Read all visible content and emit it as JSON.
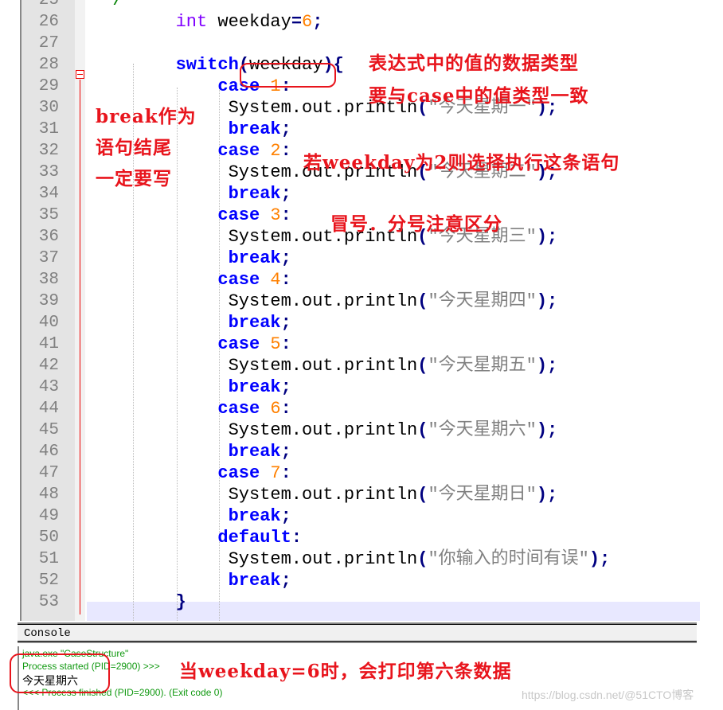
{
  "editor": {
    "first_line_partial": "25",
    "lines": [
      {
        "n": "25",
        "indent": 0,
        "tokens": [
          {
            "t": "  /",
            "c": "cm"
          }
        ]
      },
      {
        "n": "26",
        "indent": 8,
        "tokens": [
          {
            "t": "int",
            "c": "ty"
          },
          {
            "t": " weekday",
            "c": "id"
          },
          {
            "t": "=",
            "c": "op"
          },
          {
            "t": "6",
            "c": "num"
          },
          {
            "t": ";",
            "c": "op"
          }
        ]
      },
      {
        "n": "27",
        "indent": 8,
        "tokens": []
      },
      {
        "n": "28",
        "indent": 8,
        "tokens": [
          {
            "t": "switch",
            "c": "kw"
          },
          {
            "t": "(",
            "c": "op"
          },
          {
            "t": "weekday",
            "c": "id"
          },
          {
            "t": ")",
            "c": "op"
          },
          {
            "t": "{",
            "c": "op"
          }
        ]
      },
      {
        "n": "29",
        "indent": 12,
        "tokens": [
          {
            "t": "case",
            "c": "kw"
          },
          {
            "t": " 1",
            "c": "num"
          },
          {
            "t": ":",
            "c": "op"
          }
        ]
      },
      {
        "n": "30",
        "indent": 13,
        "tokens": [
          {
            "t": "System.out.println",
            "c": "id"
          },
          {
            "t": "(",
            "c": "op"
          },
          {
            "t": "\"今天星期一\"",
            "c": "str"
          },
          {
            "t": ");",
            "c": "op"
          }
        ]
      },
      {
        "n": "31",
        "indent": 13,
        "tokens": [
          {
            "t": "break",
            "c": "kw"
          },
          {
            "t": ";",
            "c": "op"
          }
        ]
      },
      {
        "n": "32",
        "indent": 12,
        "tokens": [
          {
            "t": "case",
            "c": "kw"
          },
          {
            "t": " 2",
            "c": "num"
          },
          {
            "t": ":",
            "c": "op"
          }
        ]
      },
      {
        "n": "33",
        "indent": 13,
        "tokens": [
          {
            "t": "System.out.println",
            "c": "id"
          },
          {
            "t": "(",
            "c": "op"
          },
          {
            "t": "\"今天星期二\"",
            "c": "str"
          },
          {
            "t": ");",
            "c": "op"
          }
        ]
      },
      {
        "n": "34",
        "indent": 13,
        "tokens": [
          {
            "t": "break",
            "c": "kw"
          },
          {
            "t": ";",
            "c": "op"
          }
        ]
      },
      {
        "n": "35",
        "indent": 12,
        "tokens": [
          {
            "t": "case",
            "c": "kw"
          },
          {
            "t": " 3",
            "c": "num"
          },
          {
            "t": ":",
            "c": "op"
          }
        ]
      },
      {
        "n": "36",
        "indent": 13,
        "tokens": [
          {
            "t": "System.out.println",
            "c": "id"
          },
          {
            "t": "(",
            "c": "op"
          },
          {
            "t": "\"今天星期三\"",
            "c": "str"
          },
          {
            "t": ");",
            "c": "op"
          }
        ]
      },
      {
        "n": "37",
        "indent": 13,
        "tokens": [
          {
            "t": "break",
            "c": "kw"
          },
          {
            "t": ";",
            "c": "op"
          }
        ]
      },
      {
        "n": "38",
        "indent": 12,
        "tokens": [
          {
            "t": "case",
            "c": "kw"
          },
          {
            "t": " 4",
            "c": "num"
          },
          {
            "t": ":",
            "c": "op"
          }
        ]
      },
      {
        "n": "39",
        "indent": 13,
        "tokens": [
          {
            "t": "System.out.println",
            "c": "id"
          },
          {
            "t": "(",
            "c": "op"
          },
          {
            "t": "\"今天星期四\"",
            "c": "str"
          },
          {
            "t": ");",
            "c": "op"
          }
        ]
      },
      {
        "n": "40",
        "indent": 13,
        "tokens": [
          {
            "t": "break",
            "c": "kw"
          },
          {
            "t": ";",
            "c": "op"
          }
        ]
      },
      {
        "n": "41",
        "indent": 12,
        "tokens": [
          {
            "t": "case",
            "c": "kw"
          },
          {
            "t": " 5",
            "c": "num"
          },
          {
            "t": ":",
            "c": "op"
          }
        ]
      },
      {
        "n": "42",
        "indent": 13,
        "tokens": [
          {
            "t": "System.out.println",
            "c": "id"
          },
          {
            "t": "(",
            "c": "op"
          },
          {
            "t": "\"今天星期五\"",
            "c": "str"
          },
          {
            "t": ");",
            "c": "op"
          }
        ]
      },
      {
        "n": "43",
        "indent": 13,
        "tokens": [
          {
            "t": "break",
            "c": "kw"
          },
          {
            "t": ";",
            "c": "op"
          }
        ]
      },
      {
        "n": "44",
        "indent": 12,
        "tokens": [
          {
            "t": "case",
            "c": "kw"
          },
          {
            "t": " 6",
            "c": "num"
          },
          {
            "t": ":",
            "c": "op"
          }
        ]
      },
      {
        "n": "45",
        "indent": 13,
        "tokens": [
          {
            "t": "System.out.println",
            "c": "id"
          },
          {
            "t": "(",
            "c": "op"
          },
          {
            "t": "\"今天星期六\"",
            "c": "str"
          },
          {
            "t": ");",
            "c": "op"
          }
        ]
      },
      {
        "n": "46",
        "indent": 13,
        "tokens": [
          {
            "t": "break",
            "c": "kw"
          },
          {
            "t": ";",
            "c": "op"
          }
        ]
      },
      {
        "n": "47",
        "indent": 12,
        "tokens": [
          {
            "t": "case",
            "c": "kw"
          },
          {
            "t": " 7",
            "c": "num"
          },
          {
            "t": ":",
            "c": "op"
          }
        ]
      },
      {
        "n": "48",
        "indent": 13,
        "tokens": [
          {
            "t": "System.out.println",
            "c": "id"
          },
          {
            "t": "(",
            "c": "op"
          },
          {
            "t": "\"今天星期日\"",
            "c": "str"
          },
          {
            "t": ");",
            "c": "op"
          }
        ]
      },
      {
        "n": "49",
        "indent": 13,
        "tokens": [
          {
            "t": "break",
            "c": "kw"
          },
          {
            "t": ";",
            "c": "op"
          }
        ]
      },
      {
        "n": "50",
        "indent": 12,
        "tokens": [
          {
            "t": "default",
            "c": "kw"
          },
          {
            "t": ":",
            "c": "op"
          }
        ]
      },
      {
        "n": "51",
        "indent": 13,
        "tokens": [
          {
            "t": "System.out.println",
            "c": "id"
          },
          {
            "t": "(",
            "c": "op"
          },
          {
            "t": "\"你输入的时间有误\"",
            "c": "str"
          },
          {
            "t": ");",
            "c": "op"
          }
        ]
      },
      {
        "n": "52",
        "indent": 13,
        "tokens": [
          {
            "t": "break",
            "c": "kw"
          },
          {
            "t": ";",
            "c": "op"
          }
        ]
      },
      {
        "n": "53",
        "indent": 8,
        "tokens": [
          {
            "t": "}",
            "c": "op"
          }
        ]
      }
    ]
  },
  "console": {
    "tab_label": "Console",
    "lines": [
      {
        "text": "java.exe \"CaseStructure\"",
        "color": "#119911"
      },
      {
        "text": "Process started (PID=2900) >>>",
        "color": "#119911"
      },
      {
        "text": "今天星期六",
        "color": "#000000"
      },
      {
        "text": "<<< Process finished (PID=2900). (Exit code 0)",
        "color": "#119911"
      }
    ]
  },
  "annotations": {
    "expr_type_1": "表达式中的值的数据类型",
    "expr_type_2": "要与case中的值类型一致",
    "break_1": "break作为",
    "break_2": "语句结尾",
    "break_3": "一定要写",
    "case2": "若weekday为2则选择执行这条语句",
    "colon": "冒号．分号注意区分",
    "result": "当weekday=6时，会打印第六条数据",
    "color": "#e8141c"
  },
  "watermark": "https://blog.csdn.net/@51CTO博客"
}
